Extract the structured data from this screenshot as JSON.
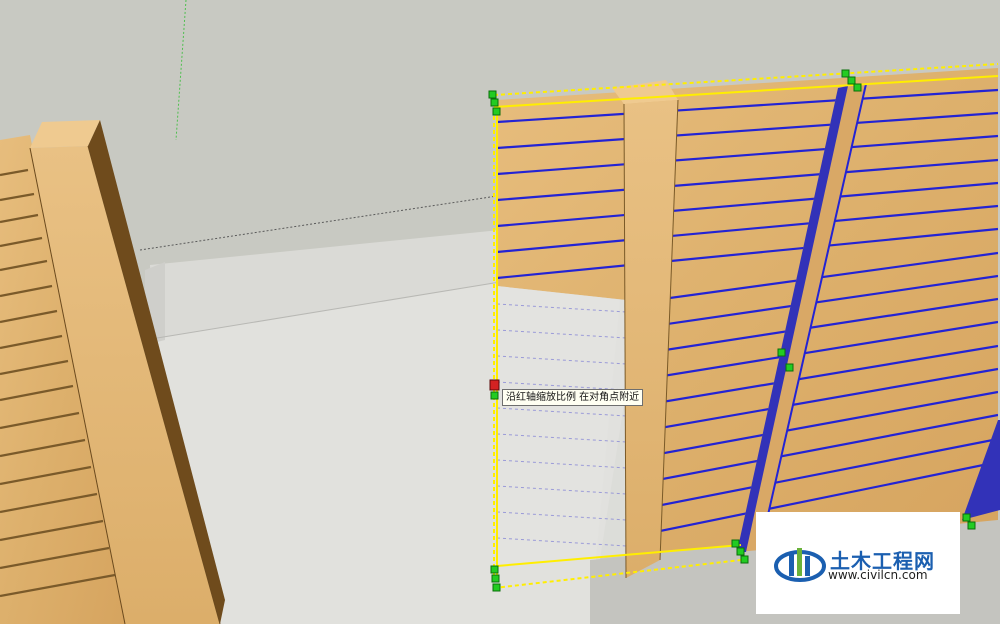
{
  "tooltip": {
    "text": "沿红轴缩放比例 在对角点附近"
  },
  "watermark": {
    "title": "土木工程网",
    "url": "www.civilcn.com"
  },
  "colors": {
    "sky": "#c8c9c2",
    "ground": "#dadad6",
    "wood": "#e0b36f",
    "wood_dark": "#a87b3e",
    "bounding_box": "#ffee00",
    "selected_edge": "#2020d0",
    "grip": "#22cc22",
    "active_grip": "#d42222",
    "logo_blue": "#1b5fb0",
    "logo_green": "#6ab23a"
  }
}
